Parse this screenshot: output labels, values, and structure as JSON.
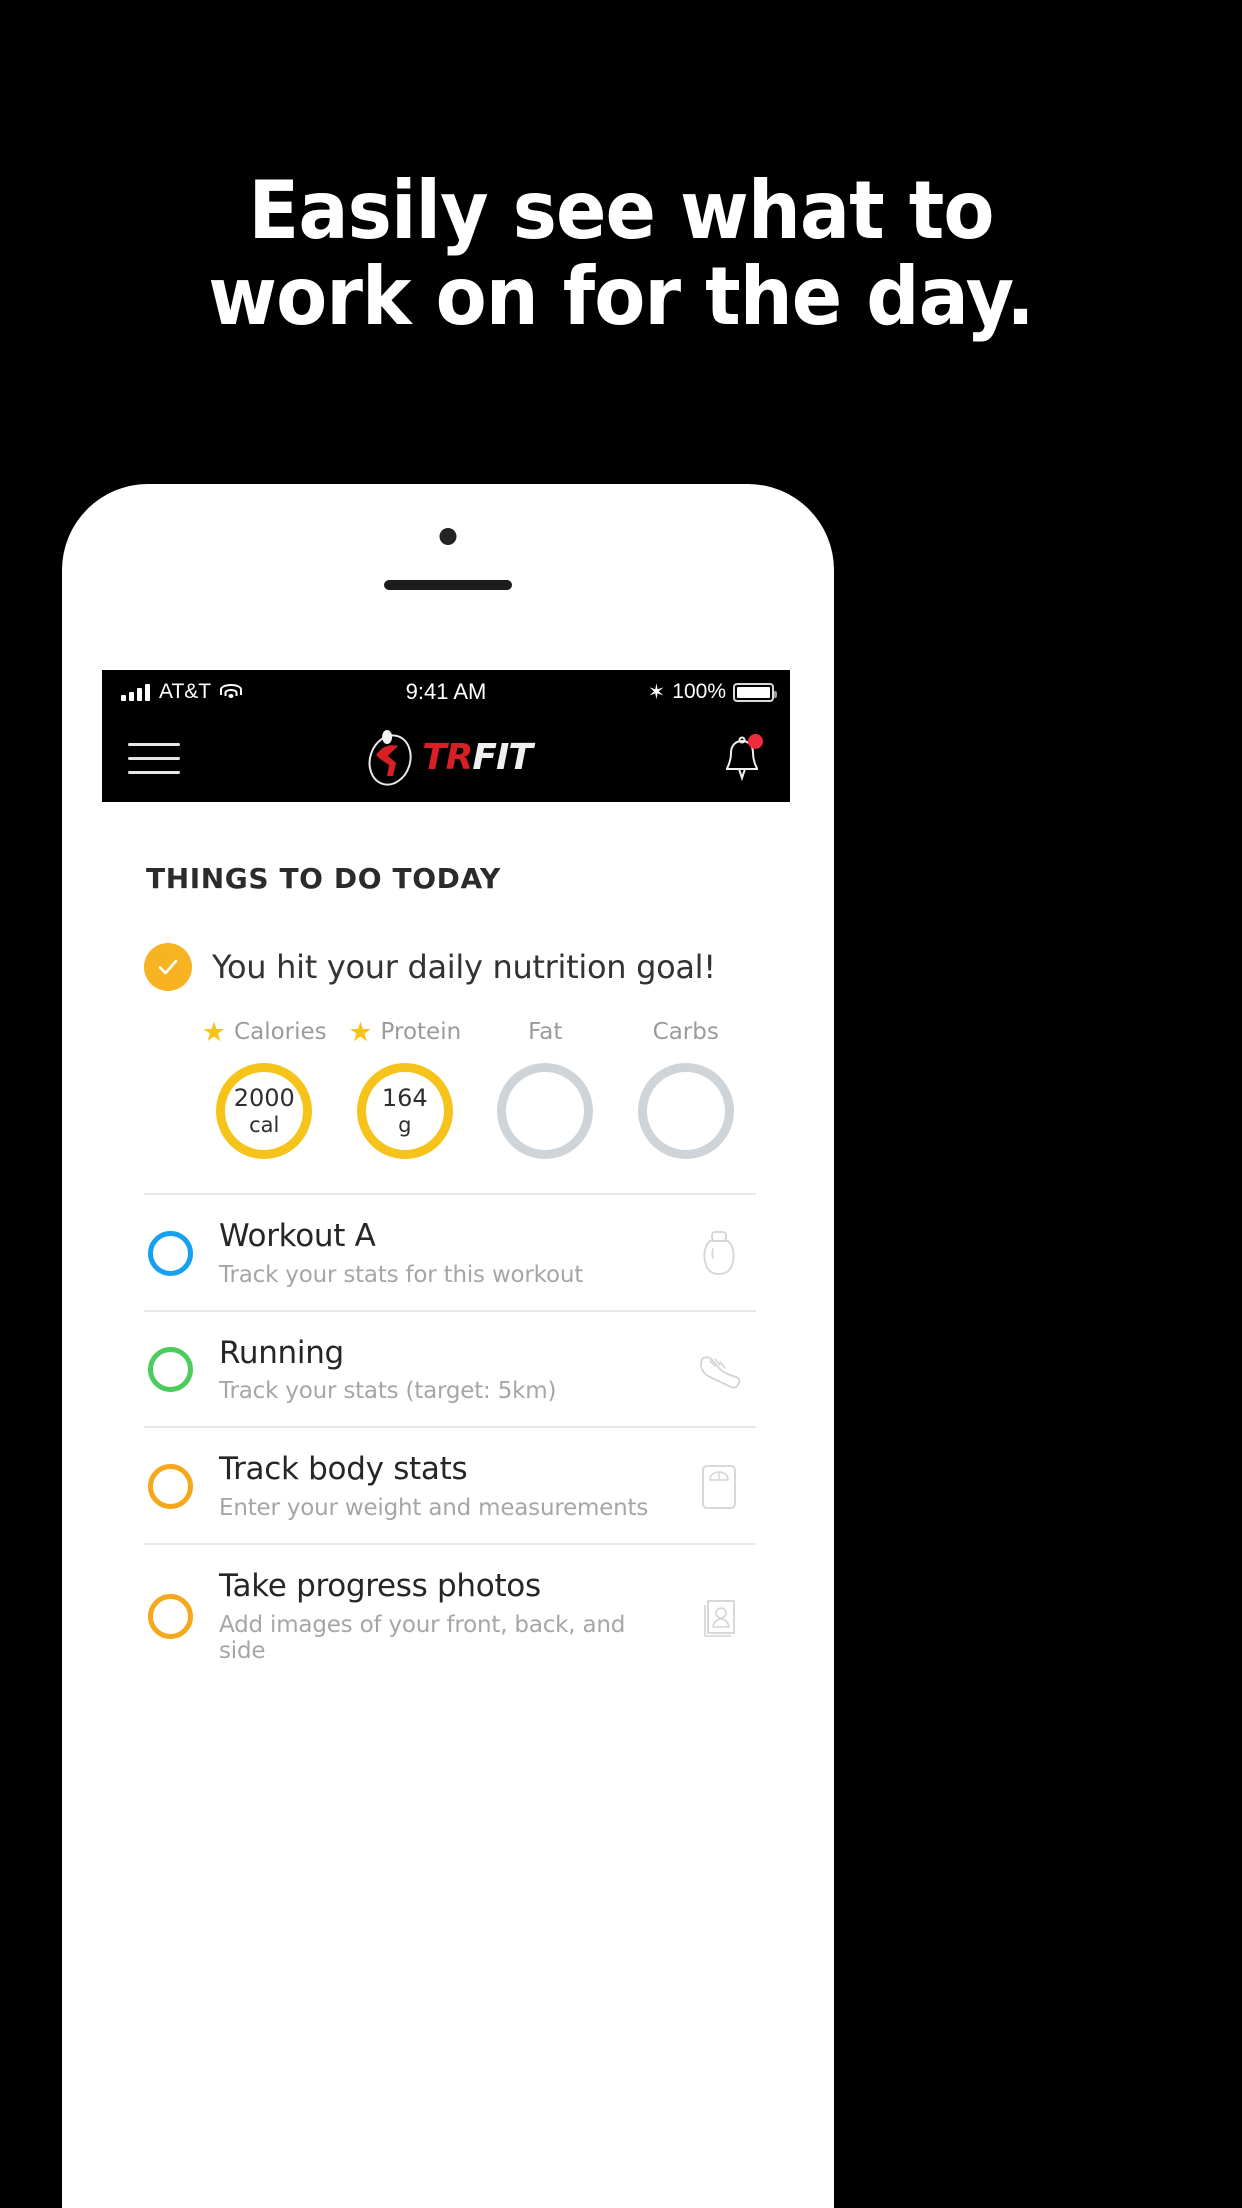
{
  "marketing": {
    "headline_line1": "Easily see what to",
    "headline_line2": "work on for the day."
  },
  "status_bar": {
    "carrier": "AT&T",
    "time": "9:41 AM",
    "battery_percent": "100%",
    "bluetooth_icon": "bluetooth-icon",
    "wifi_icon": "wifi-icon",
    "signal_icon": "signal-bars-icon"
  },
  "navbar": {
    "menu_icon": "hamburger-menu-icon",
    "logo_tr": "TR",
    "logo_fit": "FIT",
    "logo_mark": "runner-figure-icon",
    "bell_icon": "notification-bell-icon",
    "has_notification": true
  },
  "main": {
    "section_title": "THINGS TO DO TODAY",
    "nutrition": {
      "status_text": "You hit your daily nutrition goal!",
      "completed": true,
      "macros": [
        {
          "label": "Calories",
          "value": "2000",
          "unit": "cal",
          "starred": true,
          "achieved": true
        },
        {
          "label": "Protein",
          "value": "164",
          "unit": "g",
          "starred": true,
          "achieved": true
        },
        {
          "label": "Fat",
          "value": "",
          "unit": "",
          "starred": false,
          "achieved": false
        },
        {
          "label": "Carbs",
          "value": "",
          "unit": "",
          "starred": false,
          "achieved": false
        }
      ]
    },
    "tasks": [
      {
        "title": "Workout A",
        "subtitle": "Track your stats for this workout",
        "color": "#18A0F0",
        "icon": "kettlebell-icon"
      },
      {
        "title": "Running",
        "subtitle": "Track your stats (target: 5km)",
        "color": "#4DCB5F",
        "icon": "running-shoe-icon"
      },
      {
        "title": "Track body stats",
        "subtitle": "Enter your weight and measurements",
        "color": "#F5A81C",
        "icon": "weight-scale-icon"
      },
      {
        "title": "Take progress photos",
        "subtitle": "Add images of your front, back, and side",
        "color": "#F5A81C",
        "icon": "photos-icon"
      }
    ]
  },
  "colors": {
    "accent_yellow": "#F6C31A",
    "accent_orange": "#F7B322",
    "brand_red": "#D81F26",
    "blue": "#18A0F0",
    "green": "#4DCB5F",
    "muted_gray": "#CFD4D8"
  }
}
